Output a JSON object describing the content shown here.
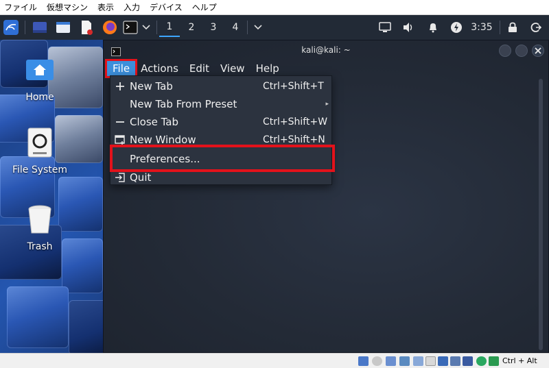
{
  "host_menu": [
    "ファイル",
    "仮想マシン",
    "表示",
    "入力",
    "デバイス",
    "ヘルプ"
  ],
  "panel": {
    "workspaces": [
      "1",
      "2",
      "3",
      "4"
    ],
    "active_workspace": "1",
    "clock": "3:35",
    "launchers": [
      "kali-menu-icon",
      "desktop-icon",
      "file-manager-icon",
      "text-editor-icon",
      "firefox-icon",
      "terminal-icon"
    ],
    "tray": [
      "display-icon",
      "volume-icon",
      "notification-bell-icon",
      "power-manager-icon",
      "lock-icon",
      "logout-icon"
    ]
  },
  "desktop": {
    "icons": [
      {
        "label": "Home",
        "icon": "home-folder-icon"
      },
      {
        "label": "File System",
        "icon": "filesystem-drive-icon"
      },
      {
        "label": "Trash",
        "icon": "trash-icon"
      }
    ]
  },
  "terminal": {
    "title": "kali@kali: ~",
    "menu": [
      "File",
      "Actions",
      "Edit",
      "View",
      "Help"
    ],
    "file_menu": [
      {
        "label": "New Tab",
        "shortcut": "Ctrl+Shift+T",
        "icon": "plus-icon"
      },
      {
        "label": "New Tab From Preset",
        "shortcut": "",
        "icon": "",
        "submenu": true
      },
      {
        "label": "Close Tab",
        "shortcut": "Ctrl+Shift+W",
        "icon": "minus-icon"
      },
      {
        "label": "New Window",
        "shortcut": "Ctrl+Shift+N",
        "icon": "new-window-icon"
      },
      {
        "label": "Preferences...",
        "shortcut": "",
        "icon": ""
      },
      {
        "label": "Quit",
        "shortcut": "",
        "icon": "quit-icon"
      }
    ]
  },
  "statusbar": {
    "host_key": "Ctrl + Alt"
  },
  "colors": {
    "highlight_red": "#e3121b",
    "selection_blue": "#3c8fdb",
    "panel_bg": "#222a36"
  }
}
